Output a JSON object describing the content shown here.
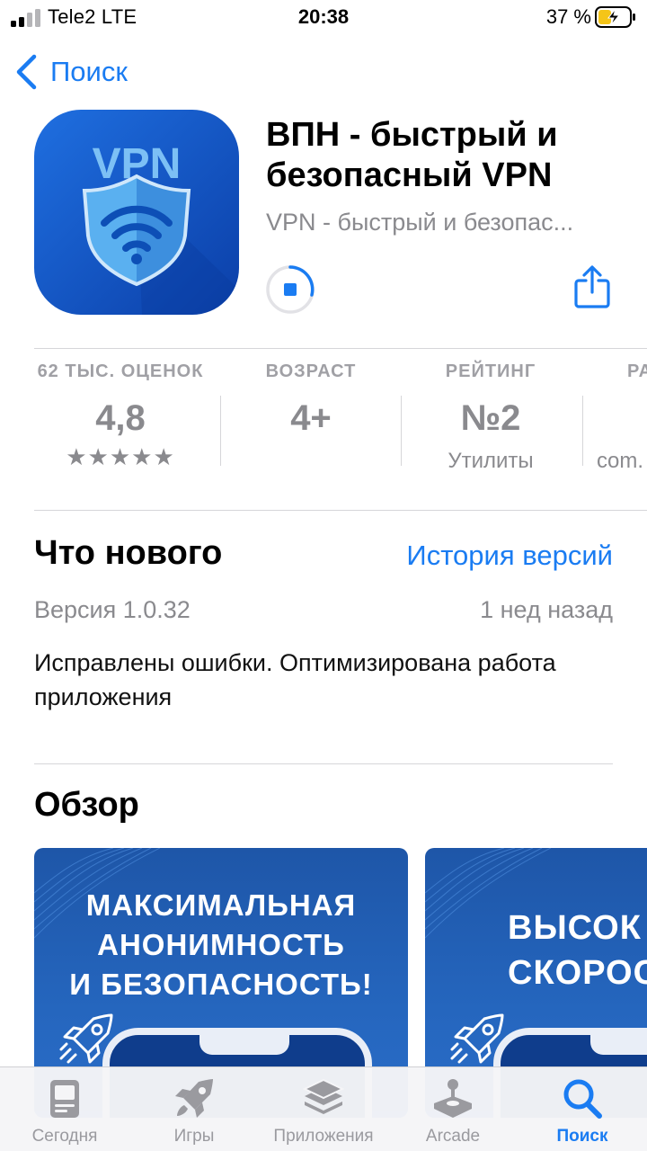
{
  "status_bar": {
    "carrier": "Tele2   LTE",
    "time": "20:38",
    "battery": "37 %"
  },
  "nav": {
    "back_label": "Поиск"
  },
  "app": {
    "title": "ВПН - быстрый и безопасный VPN",
    "subtitle": "VPN - быстрый и безопас...",
    "icon_text": "VPN"
  },
  "info": {
    "ratings": {
      "caption": "62 ТЫС. ОЦЕНОК",
      "value": "4,8",
      "stars": "★★★★★"
    },
    "age": {
      "caption": "ВОЗРАСТ",
      "value": "4+"
    },
    "chart": {
      "caption": "РЕЙТИНГ",
      "value": "№2",
      "sub": "Утилиты"
    },
    "developer": {
      "caption": "РА",
      "sub": "com."
    }
  },
  "whats_new": {
    "title": "Что нового",
    "history_link": "История версий",
    "version": "Версия 1.0.32",
    "date": "1 нед назад",
    "notes": "Исправлены ошибки. Оптимизирована работа приложения"
  },
  "preview": {
    "title": "Обзор",
    "shot1": [
      "МАКСИМАЛЬНАЯ",
      "АНОНИМНОСТЬ",
      "И БЕЗОПАСНОСТЬ!"
    ],
    "shot2": [
      "ВЫСОК",
      "СКОРОС"
    ]
  },
  "tabs": [
    {
      "label": "Сегодня",
      "icon": "today-icon"
    },
    {
      "label": "Игры",
      "icon": "rocket-icon"
    },
    {
      "label": "Приложения",
      "icon": "layers-icon"
    },
    {
      "label": "Arcade",
      "icon": "joystick-icon"
    },
    {
      "label": "Поиск",
      "icon": "search-icon",
      "active": true
    }
  ],
  "colors": {
    "accent": "#1a7cf2",
    "secondary_text": "#8a8a8e"
  }
}
